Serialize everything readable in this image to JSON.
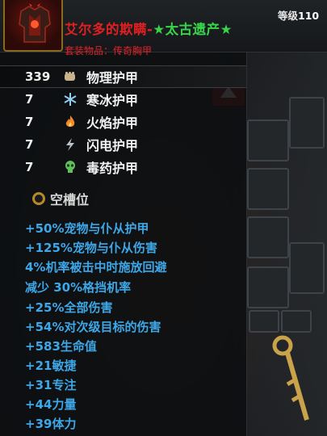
{
  "item": {
    "name": "艾尔多的欺瞒-",
    "suffix": "太古遗产",
    "star_left": "★",
    "star_right": "★",
    "level_label": "等级",
    "level_value": "110",
    "set_line": "套装物品：传奇胸甲"
  },
  "armor": {
    "primary": {
      "value": "339",
      "label": "物理护甲",
      "icon": "fist-icon"
    },
    "resists": [
      {
        "value": "7",
        "label": "寒冰护甲",
        "icon": "snowflake-icon"
      },
      {
        "value": "7",
        "label": "火焰护甲",
        "icon": "flame-icon"
      },
      {
        "value": "7",
        "label": "闪电护甲",
        "icon": "lightning-icon"
      },
      {
        "value": "7",
        "label": "毒药护甲",
        "icon": "poison-skull-icon"
      }
    ]
  },
  "socket": {
    "label": "空槽位"
  },
  "modifiers": [
    "+50%宠物与仆从护甲",
    "+125%宠物与仆从伤害",
    "4%机率被击中时施放回避",
    "减少 30%格挡机率",
    "+25%全部伤害",
    "+54%对次级目标的伤害",
    "+583生命值",
    "+21敏捷",
    "+31专注",
    "+44力量",
    "+39体力"
  ],
  "colors": {
    "title_red": "#e02020",
    "legacy_green": "#37d64a",
    "modifier_blue": "#3da7e8",
    "set_red": "#e0242a"
  }
}
